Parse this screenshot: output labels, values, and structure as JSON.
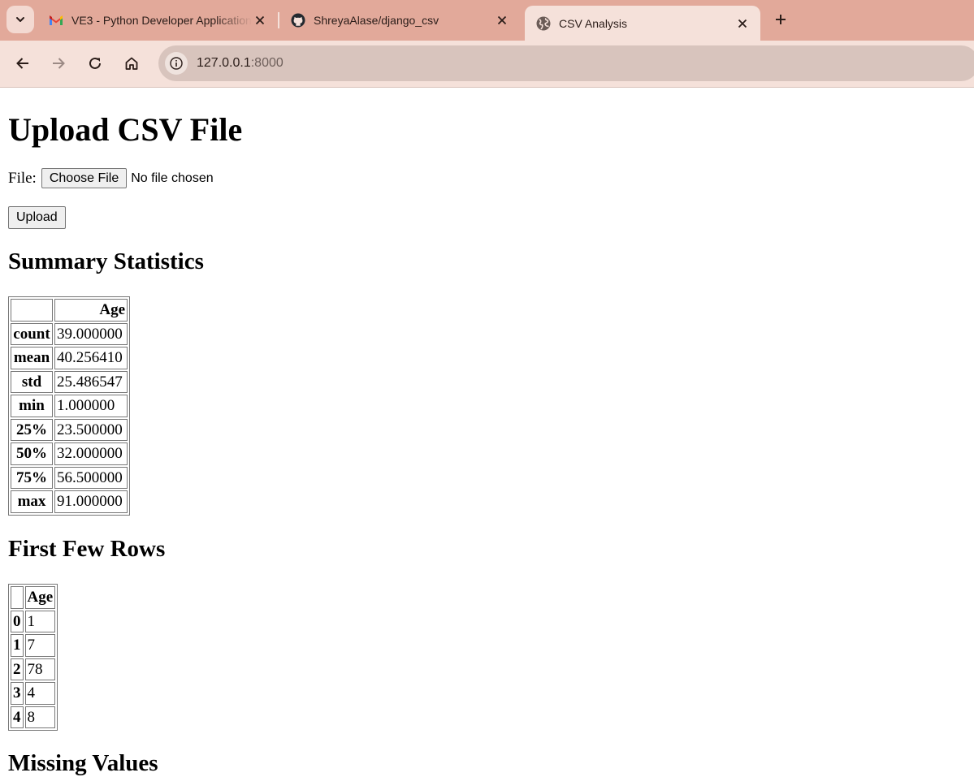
{
  "browser": {
    "tabs": [
      {
        "title": "VE3 - Python Developer Application",
        "icon": "gmail-icon",
        "active": false
      },
      {
        "title": "ShreyaAlase/django_csv",
        "icon": "github-icon",
        "active": false
      },
      {
        "title": "CSV Analysis",
        "icon": "globe-icon",
        "active": true
      }
    ],
    "address": {
      "host": "127.0.0.1",
      "port": ":8000"
    }
  },
  "page": {
    "heading": "Upload CSV File",
    "file_label": "File:",
    "choose_file_label": "Choose File",
    "no_file_text": "No file chosen",
    "upload_label": "Upload",
    "summary": {
      "heading": "Summary Statistics",
      "column": "Age",
      "rows": [
        {
          "stat": "count",
          "value": "39.000000"
        },
        {
          "stat": "mean",
          "value": "40.256410"
        },
        {
          "stat": "std",
          "value": "25.486547"
        },
        {
          "stat": "min",
          "value": "1.000000"
        },
        {
          "stat": "25%",
          "value": "23.500000"
        },
        {
          "stat": "50%",
          "value": "32.000000"
        },
        {
          "stat": "75%",
          "value": "56.500000"
        },
        {
          "stat": "max",
          "value": "91.000000"
        }
      ]
    },
    "first_rows": {
      "heading": "First Few Rows",
      "column": "Age",
      "rows": [
        {
          "index": "0",
          "value": "1"
        },
        {
          "index": "1",
          "value": "7"
        },
        {
          "index": "2",
          "value": "78"
        },
        {
          "index": "3",
          "value": "4"
        },
        {
          "index": "4",
          "value": "8"
        }
      ]
    },
    "missing_heading": "Missing Values"
  }
}
